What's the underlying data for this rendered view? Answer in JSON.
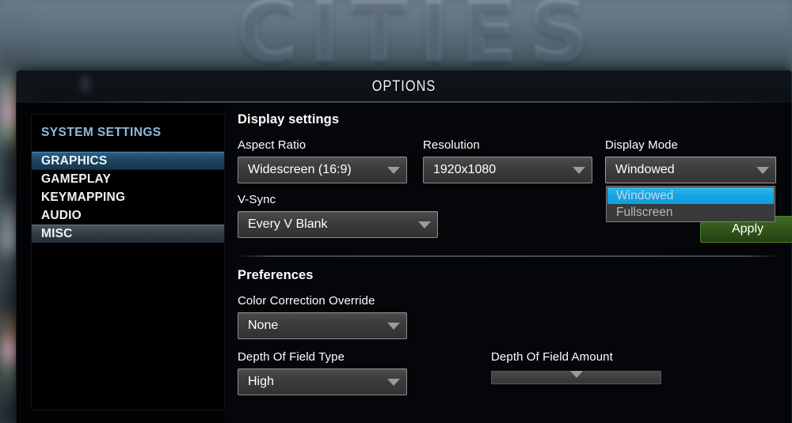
{
  "background": {
    "game_logo": "CITIES"
  },
  "window": {
    "title": "OPTIONS"
  },
  "sidebar": {
    "header": "SYSTEM SETTINGS",
    "items": [
      {
        "label": "GRAPHICS",
        "state": "selected"
      },
      {
        "label": "GAMEPLAY",
        "state": "normal"
      },
      {
        "label": "KEYMAPPING",
        "state": "normal"
      },
      {
        "label": "AUDIO",
        "state": "normal"
      },
      {
        "label": "MISC",
        "state": "hover"
      }
    ]
  },
  "content": {
    "display_settings": {
      "title": "Display settings",
      "aspect_ratio": {
        "label": "Aspect Ratio",
        "value": "Widescreen (16:9)",
        "caret": "chevron-down-icon"
      },
      "resolution": {
        "label": "Resolution",
        "value": "1920x1080",
        "caret": "chevron-down-icon"
      },
      "display_mode": {
        "label": "Display Mode",
        "value": "Windowed",
        "caret": "chevron-down-icon",
        "expanded": true,
        "options": [
          {
            "label": "Windowed",
            "highlighted": true
          },
          {
            "label": "Fullscreen",
            "highlighted": false
          }
        ]
      },
      "vsync": {
        "label": "V-Sync",
        "value": "Every V Blank",
        "caret": "chevron-down-icon"
      },
      "apply_button": {
        "label": "Apply",
        "color": "#31531a"
      }
    },
    "preferences": {
      "title": "Preferences",
      "color_correction_override": {
        "label": "Color Correction Override",
        "value": "None",
        "caret": "chevron-down-icon"
      },
      "depth_of_field_type": {
        "label": "Depth Of Field Type",
        "value": "High",
        "caret": "chevron-down-icon"
      },
      "depth_of_field_amount": {
        "label": "Depth Of Field Amount",
        "percent": 50
      }
    }
  },
  "colors": {
    "accent_blue": "#17a3e2",
    "selected_nav": "#1d4664",
    "sidebar_header_text": "#8fb9dd",
    "apply_green": "#31531a"
  }
}
